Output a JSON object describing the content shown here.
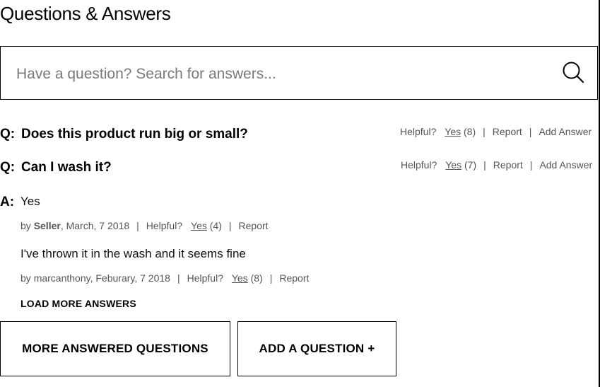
{
  "page": {
    "title": "Questions & Answers"
  },
  "search": {
    "placeholder": "Have a question? Search for answers..."
  },
  "icons": {
    "search": "search-icon"
  },
  "questions": [
    {
      "prefix": "Q:",
      "text": "Does this product run big or small?",
      "helpful_label": "Helpful?",
      "yes_label": "Yes",
      "yes_count": "(8)",
      "report_label": "Report",
      "add_answer_label": "Add Answer"
    },
    {
      "prefix": "Q:",
      "text": "Can I wash it?",
      "helpful_label": "Helpful?",
      "yes_label": "Yes",
      "yes_count": "(7)",
      "report_label": "Report",
      "add_answer_label": "Add Answer"
    }
  ],
  "answers": {
    "prefix": "A:",
    "items": [
      {
        "body": "Yes",
        "by_label": "by",
        "author": "Seller",
        "date": ", March, 7 2018",
        "helpful_label": "Helpful?",
        "yes_label": "Yes",
        "yes_count": "(4)",
        "report_label": "Report"
      },
      {
        "body": "I've thrown it in the wash and it seems fine",
        "by_label": "by",
        "author": "marcanthony",
        "date": ", Feburary, 7 2018",
        "helpful_label": "Helpful?",
        "yes_label": "Yes",
        "yes_count": "(8)",
        "report_label": "Report"
      }
    ],
    "load_more_label": "LOAD MORE ANSWERS"
  },
  "actions": {
    "more_questions_label": "MORE ANSWERED QUESTIONS",
    "add_question_label": "ADD A QUESTION +"
  },
  "separator": "|"
}
